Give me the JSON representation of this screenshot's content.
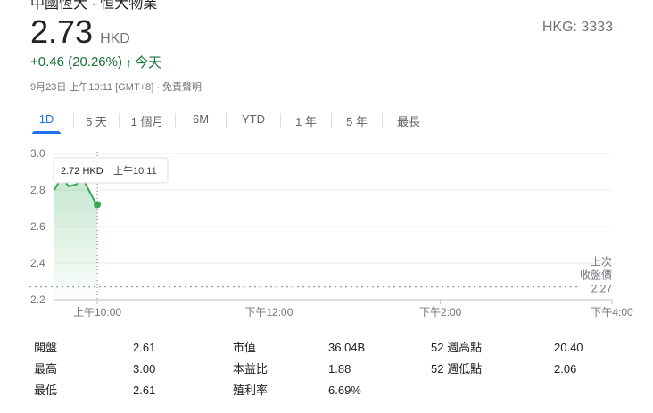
{
  "header": {
    "cut_title": "中國恆大 · 恒大物業",
    "price": "2.73",
    "currency": "HKD",
    "ticker": "HKG: 3333",
    "change": "+0.46 (20.26%)",
    "change_arrow": "↑",
    "period": "今天",
    "time_note": "9月23日 上午10:11 [GMT+8] · 免責聲明"
  },
  "tabs": [
    {
      "label": "1D",
      "active": true
    },
    {
      "label": "5 天",
      "active": false
    },
    {
      "label": "1 個月",
      "active": false
    },
    {
      "label": "6M",
      "active": false
    },
    {
      "label": "YTD",
      "active": false
    },
    {
      "label": "1 年",
      "active": false
    },
    {
      "label": "5 年",
      "active": false
    },
    {
      "label": "最長",
      "active": false
    }
  ],
  "chart_data": {
    "type": "area",
    "x_ticks": [
      "上午10:00",
      "下午12:00",
      "下午2:00",
      "下午4:00"
    ],
    "y_ticks": [
      "3.0",
      "2.8",
      "2.6",
      "2.4",
      "2.2"
    ],
    "ylim": [
      2.2,
      3.0
    ],
    "x_range_minutes": [
      570,
      960
    ],
    "points": [
      {
        "t": 570,
        "v": 2.8
      },
      {
        "t": 575,
        "v": 2.87
      },
      {
        "t": 580,
        "v": 2.82
      },
      {
        "t": 585,
        "v": 2.83
      },
      {
        "t": 590,
        "v": 2.86
      },
      {
        "t": 594,
        "v": 2.8
      },
      {
        "t": 598,
        "v": 2.74
      },
      {
        "t": 600,
        "v": 2.72
      }
    ],
    "previous_close": 2.27,
    "previous_close_label": [
      "上次",
      "收盤價"
    ],
    "previous_close_text": "2.27",
    "tooltip": {
      "price": "2.72 HKD",
      "time": "上午10:11"
    },
    "grid": true,
    "colors": {
      "line": "#34a853",
      "fill": "#e6f4ea",
      "grid": "#ebebeb",
      "axis": "#bdc1c6",
      "text": "#70757a"
    }
  },
  "stats": [
    {
      "label": "開盤",
      "value": "2.61"
    },
    {
      "label": "最高",
      "value": "3.00"
    },
    {
      "label": "最低",
      "value": "2.61"
    },
    {
      "label": "市值",
      "value": "36.04B"
    },
    {
      "label": "本益比",
      "value": "1.88"
    },
    {
      "label": "殖利率",
      "value": "6.69%"
    },
    {
      "label": "52 週高點",
      "value": "20.40"
    },
    {
      "label": "52 週低點",
      "value": "2.06"
    }
  ]
}
